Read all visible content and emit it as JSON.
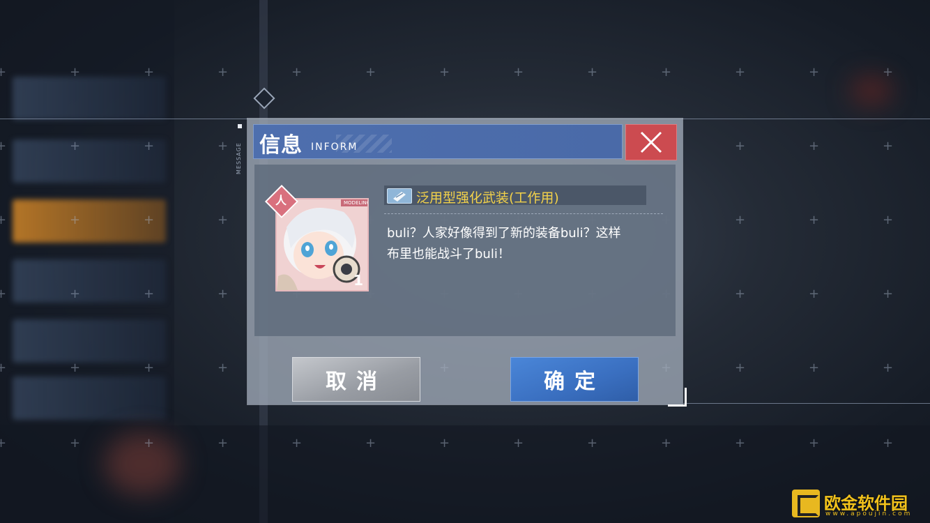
{
  "background": {
    "side_label": "MESSAGE"
  },
  "dialog": {
    "title": "信息",
    "title_en": "INFORM",
    "close_icon": "close-icon",
    "item": {
      "icon": "equipment-icon",
      "name": "泛用型强化武装(工作用)"
    },
    "avatar": {
      "tag": "MODELING",
      "count": "1",
      "badge": "人"
    },
    "message_line1": "buli？人家好像得到了新的装备buli？这样",
    "message_line2": "布里也能战斗了buli！",
    "cancel_label": "取消",
    "confirm_label": "确定"
  },
  "watermark": {
    "text": "欧金软件园",
    "url": "www.apoujin.com"
  },
  "colors": {
    "title_bar": "#4e6fae",
    "close": "#cc4b50",
    "confirm": "#3a6fc0",
    "cancel": "#989ca3",
    "item_name": "#f3d24a"
  }
}
